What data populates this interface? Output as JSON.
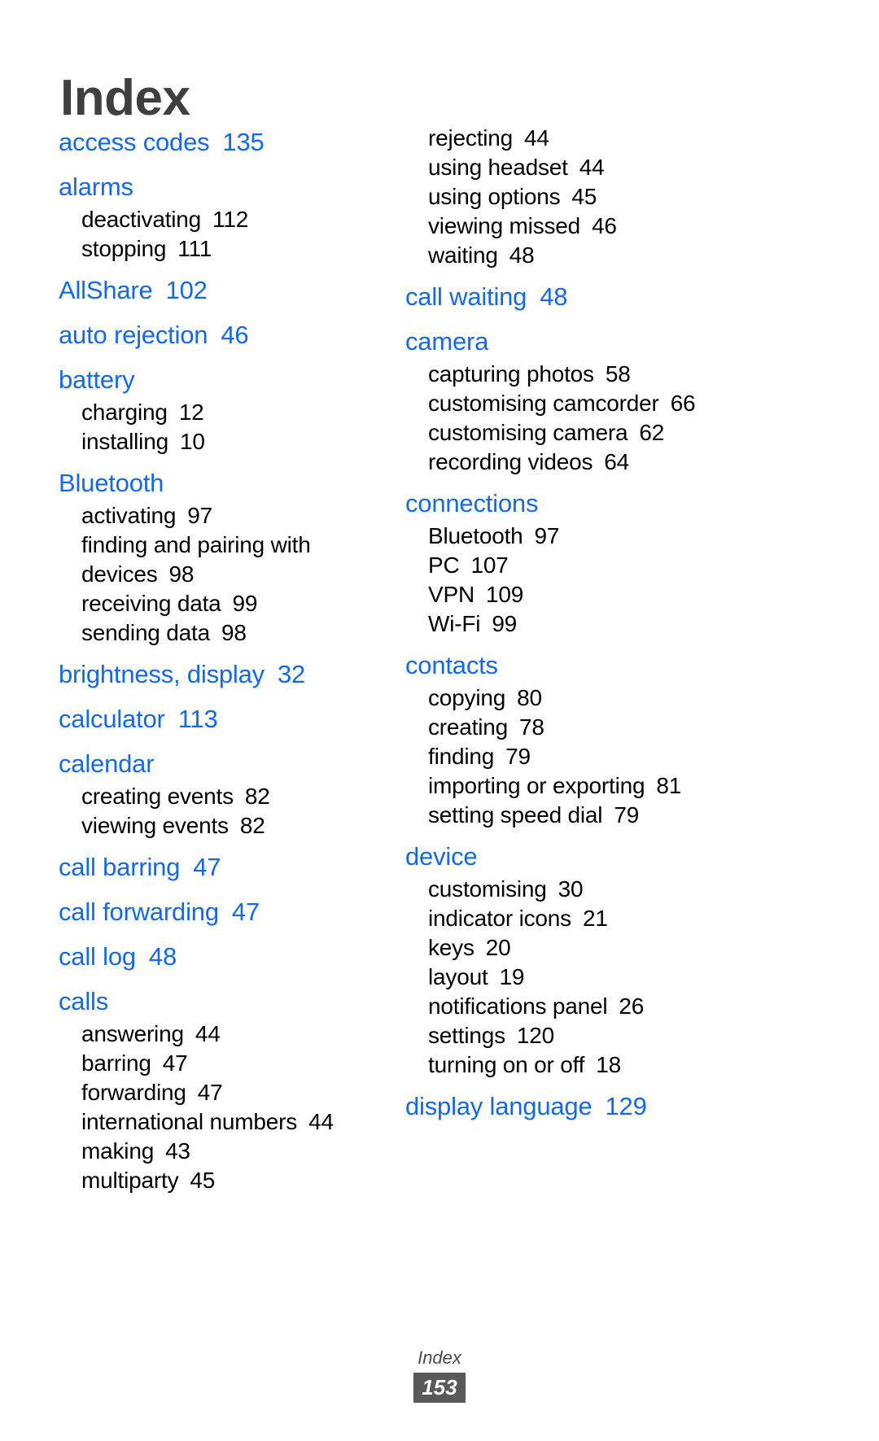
{
  "page": {
    "title": "Index",
    "accent_color": "#1569E8",
    "title_color": "#3f3f3f",
    "body_color": "#000000",
    "background": "#ffffff"
  },
  "footer": {
    "label": "Index",
    "page_number": "153",
    "badge_color": "#595959"
  },
  "columns": {
    "left": [
      {
        "heading": "access codes",
        "heading_page": "135",
        "subs": []
      },
      {
        "heading": "alarms",
        "heading_page": "",
        "subs": [
          {
            "label": "deactivating",
            "page": "112"
          },
          {
            "label": "stopping",
            "page": "111"
          }
        ]
      },
      {
        "heading": "AllShare",
        "heading_page": "102",
        "subs": []
      },
      {
        "heading": "auto rejection",
        "heading_page": "46",
        "subs": []
      },
      {
        "heading": "battery",
        "heading_page": "",
        "subs": [
          {
            "label": "charging",
            "page": "12"
          },
          {
            "label": "installing",
            "page": "10"
          }
        ]
      },
      {
        "heading": "Bluetooth",
        "heading_page": "",
        "subs": [
          {
            "label": "activating",
            "page": "97"
          },
          {
            "label": "finding and pairing with",
            "page": ""
          },
          {
            "label": "devices",
            "page": "98"
          },
          {
            "label": "receiving data",
            "page": "99"
          },
          {
            "label": "sending data",
            "page": "98"
          }
        ]
      },
      {
        "heading": "brightness, display",
        "heading_page": "32",
        "subs": []
      },
      {
        "heading": "calculator",
        "heading_page": "113",
        "subs": []
      },
      {
        "heading": "calendar",
        "heading_page": "",
        "subs": [
          {
            "label": "creating events",
            "page": "82"
          },
          {
            "label": "viewing events",
            "page": "82"
          }
        ]
      },
      {
        "heading": "call barring",
        "heading_page": "47",
        "subs": []
      },
      {
        "heading": "call forwarding",
        "heading_page": "47",
        "subs": []
      },
      {
        "heading": "call log",
        "heading_page": "48",
        "subs": []
      },
      {
        "heading": "calls",
        "heading_page": "",
        "subs": [
          {
            "label": "answering",
            "page": "44"
          },
          {
            "label": "barring",
            "page": "47"
          },
          {
            "label": "forwarding",
            "page": "47"
          },
          {
            "label": "international numbers",
            "page": "44"
          },
          {
            "label": "making",
            "page": "43"
          },
          {
            "label": "multiparty",
            "page": "45"
          }
        ]
      }
    ],
    "right": [
      {
        "heading": "",
        "heading_page": "",
        "subs": [
          {
            "label": "rejecting",
            "page": "44"
          },
          {
            "label": "using headset",
            "page": "44"
          },
          {
            "label": "using options",
            "page": "45"
          },
          {
            "label": "viewing missed",
            "page": "46"
          },
          {
            "label": "waiting",
            "page": "48"
          }
        ]
      },
      {
        "heading": "call waiting",
        "heading_page": "48",
        "subs": []
      },
      {
        "heading": "camera",
        "heading_page": "",
        "subs": [
          {
            "label": "capturing photos",
            "page": "58"
          },
          {
            "label": "customising camcorder",
            "page": "66"
          },
          {
            "label": "customising camera",
            "page": "62"
          },
          {
            "label": "recording videos",
            "page": "64"
          }
        ]
      },
      {
        "heading": "connections",
        "heading_page": "",
        "subs": [
          {
            "label": "Bluetooth",
            "page": "97"
          },
          {
            "label": "PC",
            "page": "107"
          },
          {
            "label": "VPN",
            "page": "109"
          },
          {
            "label": "Wi-Fi",
            "page": "99"
          }
        ]
      },
      {
        "heading": "contacts",
        "heading_page": "",
        "subs": [
          {
            "label": "copying",
            "page": "80"
          },
          {
            "label": "creating",
            "page": "78"
          },
          {
            "label": "finding",
            "page": "79"
          },
          {
            "label": "importing or exporting",
            "page": "81"
          },
          {
            "label": "setting speed dial",
            "page": "79"
          }
        ]
      },
      {
        "heading": "device",
        "heading_page": "",
        "subs": [
          {
            "label": "customising",
            "page": "30"
          },
          {
            "label": "indicator icons",
            "page": "21"
          },
          {
            "label": "keys",
            "page": "20"
          },
          {
            "label": "layout",
            "page": "19"
          },
          {
            "label": "notifications panel",
            "page": "26"
          },
          {
            "label": "settings",
            "page": "120"
          },
          {
            "label": "turning on or off",
            "page": "18"
          }
        ]
      },
      {
        "heading": "display language",
        "heading_page": "129",
        "subs": []
      }
    ]
  }
}
